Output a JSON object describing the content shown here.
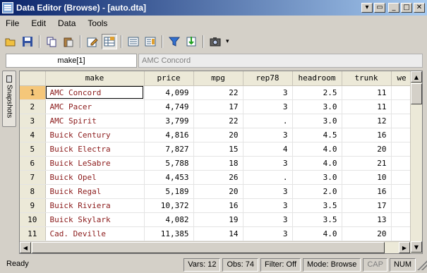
{
  "window": {
    "title": "Data Editor (Browse) - [auto.dta]"
  },
  "menu": [
    "File",
    "Edit",
    "Data",
    "Tools"
  ],
  "cellbar": {
    "ref": "make[1]",
    "value": "AMC Concord"
  },
  "sidetab": {
    "label": "Snapshots"
  },
  "table": {
    "columns": [
      "make",
      "price",
      "mpg",
      "rep78",
      "headroom",
      "trunk",
      "we"
    ],
    "rows": [
      {
        "n": "1",
        "make": "AMC Concord",
        "price": "4,099",
        "mpg": "22",
        "rep78": "3",
        "headroom": "2.5",
        "trunk": "11"
      },
      {
        "n": "2",
        "make": "AMC Pacer",
        "price": "4,749",
        "mpg": "17",
        "rep78": "3",
        "headroom": "3.0",
        "trunk": "11"
      },
      {
        "n": "3",
        "make": "AMC Spirit",
        "price": "3,799",
        "mpg": "22",
        "rep78": ".",
        "headroom": "3.0",
        "trunk": "12"
      },
      {
        "n": "4",
        "make": "Buick Century",
        "price": "4,816",
        "mpg": "20",
        "rep78": "3",
        "headroom": "4.5",
        "trunk": "16"
      },
      {
        "n": "5",
        "make": "Buick Electra",
        "price": "7,827",
        "mpg": "15",
        "rep78": "4",
        "headroom": "4.0",
        "trunk": "20"
      },
      {
        "n": "6",
        "make": "Buick LeSabre",
        "price": "5,788",
        "mpg": "18",
        "rep78": "3",
        "headroom": "4.0",
        "trunk": "21"
      },
      {
        "n": "7",
        "make": "Buick Opel",
        "price": "4,453",
        "mpg": "26",
        "rep78": ".",
        "headroom": "3.0",
        "trunk": "10"
      },
      {
        "n": "8",
        "make": "Buick Regal",
        "price": "5,189",
        "mpg": "20",
        "rep78": "3",
        "headroom": "2.0",
        "trunk": "16"
      },
      {
        "n": "9",
        "make": "Buick Riviera",
        "price": "10,372",
        "mpg": "16",
        "rep78": "3",
        "headroom": "3.5",
        "trunk": "17"
      },
      {
        "n": "10",
        "make": "Buick Skylark",
        "price": "4,082",
        "mpg": "19",
        "rep78": "3",
        "headroom": "3.5",
        "trunk": "13"
      },
      {
        "n": "11",
        "make": "Cad. Deville",
        "price": "11,385",
        "mpg": "14",
        "rep78": "3",
        "headroom": "4.0",
        "trunk": "20"
      }
    ]
  },
  "status": {
    "ready": "Ready",
    "vars": "Vars: 12",
    "obs": "Obs: 74",
    "filter": "Filter: Off",
    "mode": "Mode: Browse",
    "cap": "CAP",
    "num": "NUM"
  }
}
